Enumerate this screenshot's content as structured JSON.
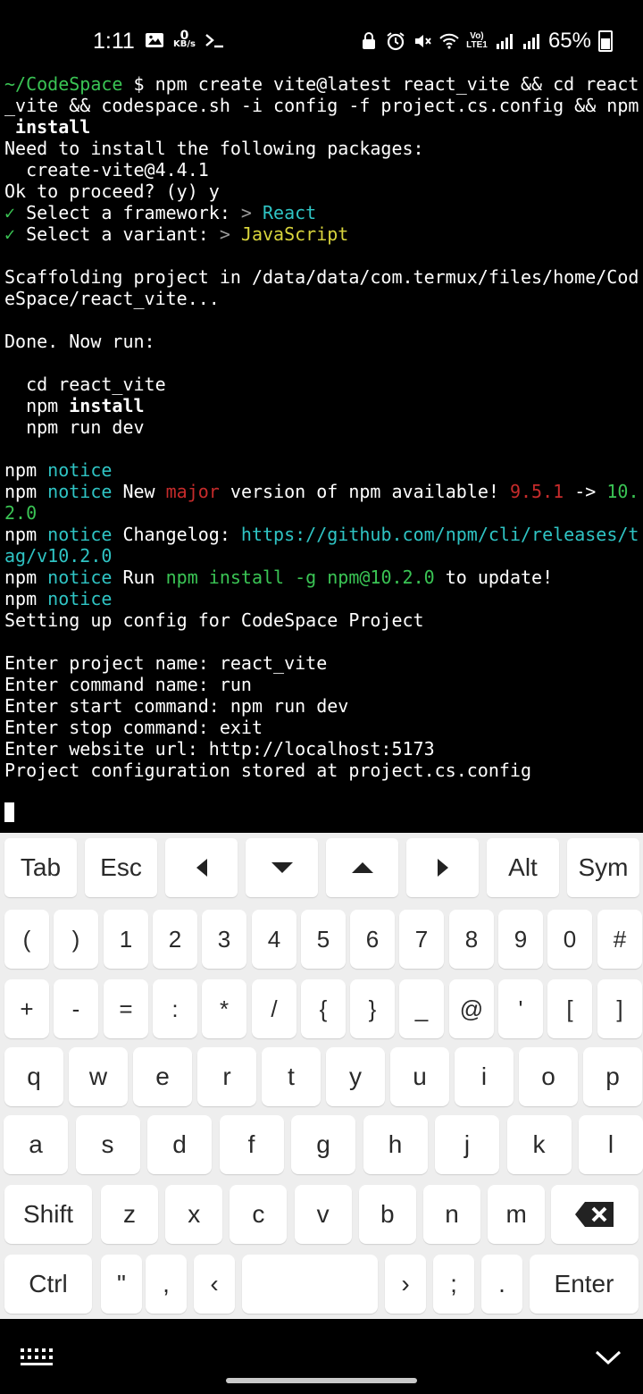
{
  "status_bar": {
    "time": "1:11",
    "net_speed_value": "0",
    "net_speed_unit": "KB/s",
    "lte_label": "Vo) LTE1",
    "battery": "65%",
    "icons": [
      "gallery-icon",
      "terminal-icon",
      "alarm-icon",
      "mute-icon",
      "wifi-icon",
      "signal-icon",
      "battery-icon"
    ]
  },
  "terminal": {
    "lines": [
      {
        "segs": [
          {
            "t": "~/CodeSpace",
            "c": "green"
          },
          {
            "t": " $ npm create vite@latest react_vite && cd react"
          }
        ]
      },
      {
        "segs": [
          {
            "t": "_vite && codespace.sh -i config -f project.cs.config && npm"
          }
        ]
      },
      {
        "segs": [
          {
            "t": " "
          },
          {
            "t": "install",
            "c": "bold"
          }
        ]
      },
      {
        "segs": [
          {
            "t": "Need to install the following packages:"
          }
        ]
      },
      {
        "segs": [
          {
            "t": "  create-vite@4.4.1"
          }
        ]
      },
      {
        "segs": [
          {
            "t": "Ok to proceed? (y) y"
          }
        ]
      },
      {
        "segs": [
          {
            "t": "✓",
            "c": "green"
          },
          {
            "t": " Select a framework: "
          },
          {
            "t": ">",
            "c": "grey"
          },
          {
            "t": " "
          },
          {
            "t": "React",
            "c": "cyan"
          }
        ]
      },
      {
        "segs": [
          {
            "t": "✓",
            "c": "green"
          },
          {
            "t": " Select a variant: "
          },
          {
            "t": ">",
            "c": "grey"
          },
          {
            "t": " "
          },
          {
            "t": "JavaScript",
            "c": "yellow"
          }
        ]
      },
      {
        "segs": [
          {
            "t": ""
          }
        ]
      },
      {
        "segs": [
          {
            "t": "Scaffolding project in /data/data/com.termux/files/home/Cod"
          }
        ]
      },
      {
        "segs": [
          {
            "t": "eSpace/react_vite..."
          }
        ]
      },
      {
        "segs": [
          {
            "t": ""
          }
        ]
      },
      {
        "segs": [
          {
            "t": "Done. Now run:"
          }
        ]
      },
      {
        "segs": [
          {
            "t": ""
          }
        ]
      },
      {
        "segs": [
          {
            "t": "  cd react_vite"
          }
        ]
      },
      {
        "segs": [
          {
            "t": "  npm "
          },
          {
            "t": "install",
            "c": "bold"
          }
        ]
      },
      {
        "segs": [
          {
            "t": "  npm run dev"
          }
        ]
      },
      {
        "segs": [
          {
            "t": ""
          }
        ]
      },
      {
        "segs": [
          {
            "t": "npm "
          },
          {
            "t": "notice",
            "c": "cyan"
          }
        ]
      },
      {
        "segs": [
          {
            "t": "npm "
          },
          {
            "t": "notice",
            "c": "cyan"
          },
          {
            "t": " New "
          },
          {
            "t": "major",
            "c": "red"
          },
          {
            "t": " version of npm available! "
          },
          {
            "t": "9.5.1",
            "c": "red"
          },
          {
            "t": " -> "
          },
          {
            "t": "10.",
            "c": "green"
          }
        ]
      },
      {
        "segs": [
          {
            "t": "2.0",
            "c": "green"
          }
        ]
      },
      {
        "segs": [
          {
            "t": "npm "
          },
          {
            "t": "notice",
            "c": "cyan"
          },
          {
            "t": " Changelog: "
          },
          {
            "t": "https://github.com/npm/cli/releases/t",
            "c": "cyan"
          }
        ]
      },
      {
        "segs": [
          {
            "t": "ag/v10.2.0",
            "c": "cyan"
          }
        ]
      },
      {
        "segs": [
          {
            "t": "npm "
          },
          {
            "t": "notice",
            "c": "cyan"
          },
          {
            "t": " Run "
          },
          {
            "t": "npm install -g npm@10.2.0",
            "c": "green"
          },
          {
            "t": " to update!"
          }
        ]
      },
      {
        "segs": [
          {
            "t": "npm "
          },
          {
            "t": "notice",
            "c": "cyan"
          }
        ]
      },
      {
        "segs": [
          {
            "t": "Setting up config for CodeSpace Project"
          }
        ]
      },
      {
        "segs": [
          {
            "t": ""
          }
        ]
      },
      {
        "segs": [
          {
            "t": "Enter project name: react_vite"
          }
        ]
      },
      {
        "segs": [
          {
            "t": "Enter command name: run"
          }
        ]
      },
      {
        "segs": [
          {
            "t": "Enter start command: npm run dev"
          }
        ]
      },
      {
        "segs": [
          {
            "t": "Enter stop command: exit"
          }
        ]
      },
      {
        "segs": [
          {
            "t": "Enter website url: http://localhost:5173"
          }
        ]
      },
      {
        "segs": [
          {
            "t": "Project configuration stored at project.cs.config"
          }
        ]
      },
      {
        "segs": [
          {
            "t": ""
          }
        ]
      }
    ]
  },
  "extra_keys": [
    "Tab",
    "Esc",
    "◀",
    "▼",
    "▲",
    "▶",
    "Alt",
    "Sym"
  ],
  "keyboard": {
    "row1": [
      "(",
      ")",
      "1",
      "2",
      "3",
      "4",
      "5",
      "6",
      "7",
      "8",
      "9",
      "0",
      "#"
    ],
    "row2": [
      "+",
      "-",
      "=",
      ":",
      "*",
      "/",
      "{",
      "}",
      "_",
      "@",
      "'",
      "[",
      "]"
    ],
    "row3": [
      "q",
      "w",
      "e",
      "r",
      "t",
      "y",
      "u",
      "i",
      "o",
      "p"
    ],
    "row4": [
      "a",
      "s",
      "d",
      "f",
      "g",
      "h",
      "j",
      "k",
      "l"
    ],
    "row5": [
      "Shift",
      "z",
      "x",
      "c",
      "v",
      "b",
      "n",
      "m",
      "⌫"
    ],
    "row6": [
      "Ctrl",
      "\"",
      ",",
      "‹",
      "",
      "›",
      ";",
      ".",
      "Enter"
    ]
  },
  "nav": {
    "left_icon": "keyboard-icon",
    "right_icon": "chevron-down-icon"
  }
}
